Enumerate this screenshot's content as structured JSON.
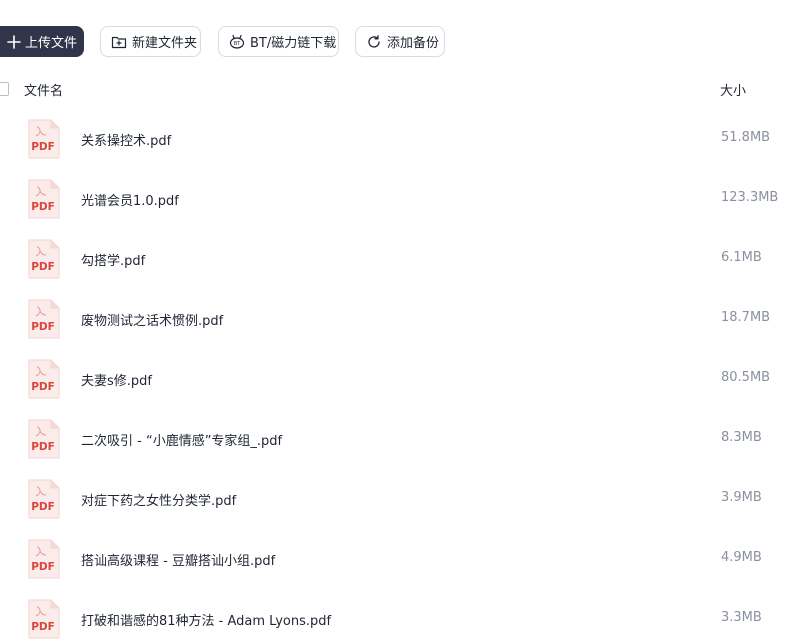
{
  "toolbar": {
    "upload_label": "上传文件",
    "new_folder_label": "新建文件夹",
    "bt_label": "BT/磁力链下载",
    "backup_label": "添加备份"
  },
  "columns": {
    "name": "文件名",
    "size": "大小"
  },
  "file_icon_text": "PDF",
  "colors": {
    "primary_button": "#30354a",
    "pdf_red": "#d9463a",
    "size_text": "#8b90a0"
  },
  "files": [
    {
      "name": "关系操控术.pdf",
      "size": "51.8MB"
    },
    {
      "name": "光谱会员1.0.pdf",
      "size": "123.3MB"
    },
    {
      "name": "勾搭学.pdf",
      "size": "6.1MB"
    },
    {
      "name": "废物测试之话术惯例.pdf",
      "size": "18.7MB"
    },
    {
      "name": "夫妻s修.pdf",
      "size": "80.5MB"
    },
    {
      "name": "二次吸引 - “小鹿情感”专家组_.pdf",
      "size": "8.3MB"
    },
    {
      "name": "对症下药之女性分类学.pdf",
      "size": "3.9MB"
    },
    {
      "name": "搭讪高级课程 - 豆瓣搭讪小组.pdf",
      "size": "4.9MB"
    },
    {
      "name": "打破和谐感的81种方法 - Adam Lyons.pdf",
      "size": "3.3MB"
    }
  ]
}
